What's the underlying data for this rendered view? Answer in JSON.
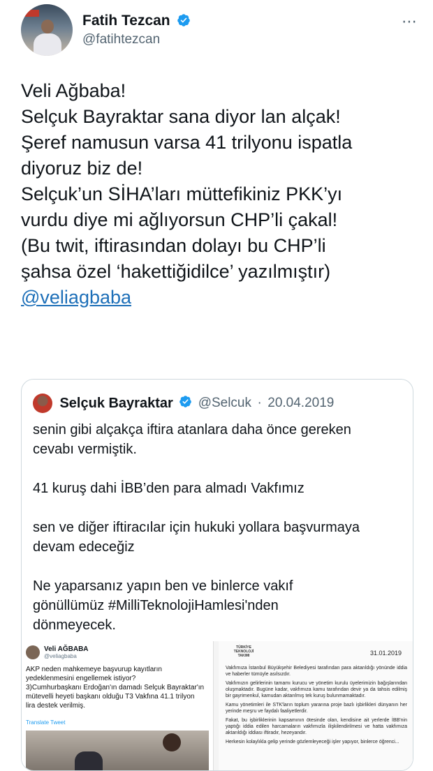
{
  "author": {
    "name": "Fatih Tezcan",
    "handle": "@fatihtezcan",
    "more_icon": "⋯"
  },
  "tweet": {
    "lines": [
      "Veli Ağbaba!",
      "Selçuk Bayraktar sana diyor lan alçak!",
      "Şeref namusun varsa 41 trilyonu ispatla",
      "diyoruz biz de!",
      "Selçuk’un SİHA’ları müttefikiniz PKK’yı",
      "vurdu diye mi ağlıyorsun CHP’li çakal!",
      "(Bu twit, iftirasından dolayı bu CHP’li",
      "şahsa özel ‘hakettiğidilce’ yazılmıştır)"
    ],
    "mention": "@veliagbaba"
  },
  "quote": {
    "name": "Selçuk Bayraktar",
    "handle": "@Selcuk",
    "separator": "·",
    "date": "20.04.2019",
    "lines": [
      "senin gibi alçakça iftira atanlara daha önce gereken",
      "cevabı vermiştik.",
      "",
      "41 kuruş dahi İBB’den para almadı Vakfımız",
      "",
      "sen ve diğer iftiracılar için hukuki yollara başvurmaya",
      "devam edeceğiz",
      "",
      "Ne yaparsanız yapın ben ve binlerce vakıf",
      "gönüllümüz #MilliTeknolojiHamlesi'nden",
      "dönmeyecek."
    ]
  },
  "embedded_tweet": {
    "name": "Veli AĞBABA",
    "handle": "@veliagbaba",
    "lines": [
      "AKP neden mahkemeye başvurup kayıtların",
      "yedeklenmesini engellemek istiyor?",
      "3)Cumhurbaşkanı Erdoğan'ın damadı Selçuk Bayraktar'ın",
      "mütevelli heyeti başkanı olduğu T3 Vakfına 41.1 trilyon",
      "lira destek verilmiş."
    ],
    "translate": "Translate Tweet"
  },
  "document": {
    "logo": "TÜRKİYE TEKNOLOJİ TAKIMI",
    "date": "31.01.2019",
    "paragraphs": [
      "Vakfımıza İstanbul Büyükşehir Belediyesi tarafından para aktarıldığı yönünde iddia ve haberler tümüyle asılsızdır.",
      "Vakfımızın gelirlerinin tamamı kurucu ve yönetim kurulu üyelerimizin bağışlarından oluşmaktadır. Bugüne kadar, vakfımıza kamu tarafından devir ya da tahsis edilmiş bir gayrimenkul, kamudan aktarılmış tek kuruş bulunmamaktadır.",
      "Kamu yönetimleri ile STK'ların toplum yararına proje bazlı işbirlikleri dünyanın her yerinde meşru ve faydalı faaliyetlerdir.",
      "Fakat, bu işbirliklerinin kapsamının ötesinde olan, kendisine ait yerlerde İBB'nin yaptığı iddia edilen harcamaların vakfımızla ilişkilendirilmesi ve hatta vakfımıza aktarıldığı iddiası iftiradır, hezeyandır.",
      "Herkesin kolaylıkla gelip yerinde gözlemleyeceği işler yapıyor, binlerce öğrenci..."
    ]
  },
  "colors": {
    "link": "#1d6fb8",
    "verified": "#1d9bf0",
    "secondary_text": "#536471",
    "border": "#cfd9de"
  }
}
